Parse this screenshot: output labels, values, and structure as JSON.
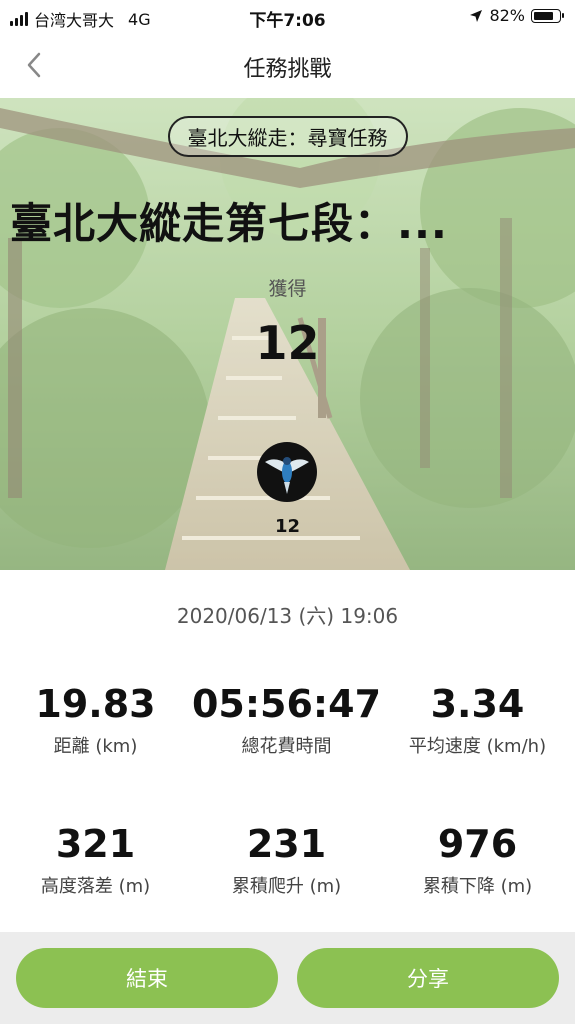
{
  "status_bar": {
    "carrier": "台湾大哥大",
    "network": "4G",
    "time": "下午7:06",
    "battery_percent": "82%",
    "battery_level": 0.82,
    "icons": [
      "signal-icon",
      "location-arrow-icon",
      "battery-icon"
    ]
  },
  "nav": {
    "title": "任務挑戰",
    "back_icon": "chevron-left-icon"
  },
  "hero": {
    "mission_tag": "臺北大縱走：尋寶任務",
    "route_title": "臺北大縱走第七段：...",
    "earned_label": "獲得",
    "earned_value": "12",
    "badge_icon": "bird-badge-icon",
    "badge_count": "12"
  },
  "date": "2020/06/13 (六) 19:06",
  "stats": [
    {
      "value": "19.83",
      "label": "距離 (km)"
    },
    {
      "value": "05:56:47",
      "label": "總花費時間"
    },
    {
      "value": "3.34",
      "label": "平均速度 (km/h)"
    },
    {
      "value": "321",
      "label": "高度落差 (m)"
    },
    {
      "value": "231",
      "label": "累積爬升 (m)"
    },
    {
      "value": "976",
      "label": "累積下降 (m)"
    }
  ],
  "buttons": {
    "end": "結束",
    "share": "分享"
  },
  "colors": {
    "accent_green": "#8cc152",
    "bottom_bar": "#ececec"
  }
}
